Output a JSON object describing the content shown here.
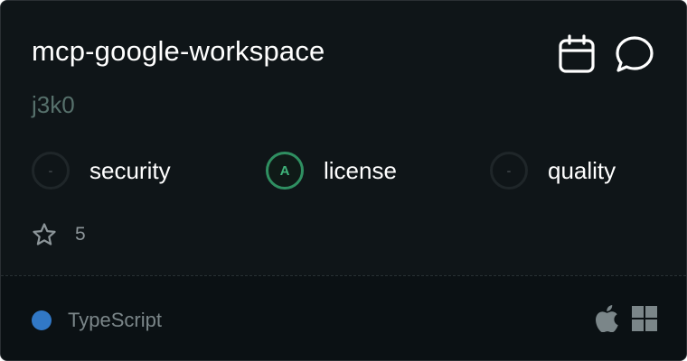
{
  "repo": {
    "name": "mcp-google-workspace",
    "owner": "j3k0"
  },
  "actions": [
    {
      "icon": "calendar-icon"
    },
    {
      "icon": "chat-bubble-icon"
    }
  ],
  "scores": [
    {
      "key": "security",
      "label": "security",
      "grade": "-"
    },
    {
      "key": "license",
      "label": "license",
      "grade": "A"
    },
    {
      "key": "quality",
      "label": "quality",
      "grade": "-"
    }
  ],
  "stars": {
    "icon": "star-icon",
    "count": "5"
  },
  "footer": {
    "language": "TypeScript",
    "language_color": "#3178c6",
    "platforms": [
      "apple-icon",
      "windows-icon"
    ]
  }
}
